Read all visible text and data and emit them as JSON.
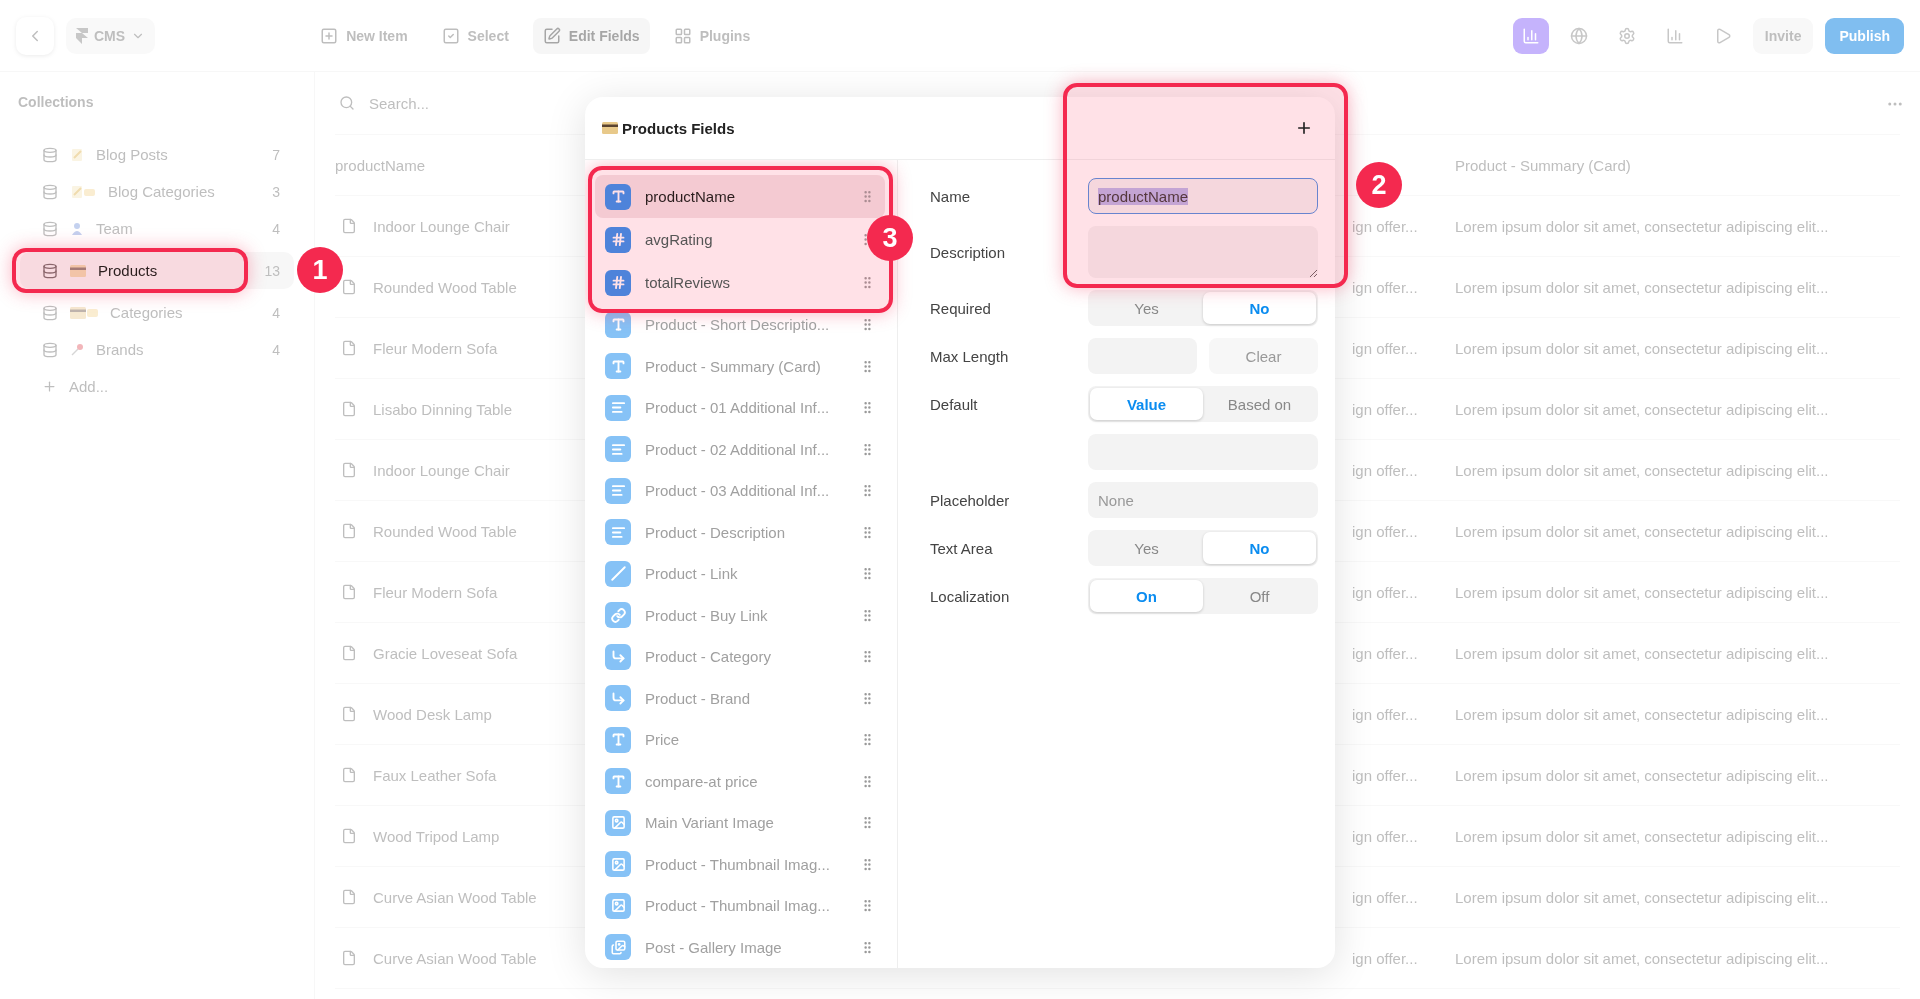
{
  "topbar": {
    "project": "CMS",
    "toolbar": [
      {
        "label": "New Item",
        "selected": false
      },
      {
        "label": "Select",
        "selected": false
      },
      {
        "label": "Edit Fields",
        "selected": true
      },
      {
        "label": "Plugins",
        "selected": false
      }
    ],
    "invite": "Invite",
    "publish": "Publish"
  },
  "sidebar": {
    "title": "Collections",
    "items": [
      {
        "name": "Blog Posts",
        "count": "7",
        "selected": false
      },
      {
        "name": "Blog Categories",
        "count": "3",
        "selected": false
      },
      {
        "name": "Team",
        "count": "4",
        "selected": false
      },
      {
        "name": "Products",
        "count": "13",
        "selected": true,
        "callout": "1"
      },
      {
        "name": "Categories",
        "count": "4",
        "selected": false
      },
      {
        "name": "Brands",
        "count": "4",
        "selected": false
      }
    ],
    "add": "Add..."
  },
  "table": {
    "search_placeholder": "Search...",
    "column_1": "productName",
    "column_3": "Product - Summary (Card)",
    "rows": [
      {
        "name": "Indoor Lounge Chair",
        "column_2": "ign offer...",
        "summary": "Lorem ipsum dolor sit amet, consectetur adipiscing elit..."
      },
      {
        "name": "Rounded Wood Table",
        "column_2": "ign offer...",
        "summary": "Lorem ipsum dolor sit amet, consectetur adipiscing elit..."
      },
      {
        "name": "Fleur Modern Sofa",
        "column_2": "ign offer...",
        "summary": "Lorem ipsum dolor sit amet, consectetur adipiscing elit..."
      },
      {
        "name": "Lisabo Dinning Table",
        "column_2": "ign offer...",
        "summary": "Lorem ipsum dolor sit amet, consectetur adipiscing elit..."
      },
      {
        "name": "Indoor Lounge Chair",
        "column_2": "ign offer...",
        "summary": "Lorem ipsum dolor sit amet, consectetur adipiscing elit..."
      },
      {
        "name": "Rounded Wood Table",
        "column_2": "ign offer...",
        "summary": "Lorem ipsum dolor sit amet, consectetur adipiscing elit..."
      },
      {
        "name": "Fleur Modern Sofa",
        "column_2": "ign offer...",
        "summary": "Lorem ipsum dolor sit amet, consectetur adipiscing elit..."
      },
      {
        "name": "Gracie Loveseat Sofa",
        "column_2": "ign offer...",
        "summary": "Lorem ipsum dolor sit amet, consectetur adipiscing elit..."
      },
      {
        "name": "Wood Desk Lamp",
        "column_2": "ign offer...",
        "summary": "Lorem ipsum dolor sit amet, consectetur adipiscing elit..."
      },
      {
        "name": "Faux Leather Sofa",
        "column_2": "ign offer...",
        "summary": "Lorem ipsum dolor sit amet, consectetur adipiscing elit..."
      },
      {
        "name": "Wood Tripod Lamp",
        "column_2": "ign offer...",
        "summary": "Lorem ipsum dolor sit amet, consectetur adipiscing elit..."
      },
      {
        "name": "Curve Asian Wood Table",
        "column_2": "ign offer...",
        "summary": "Lorem ipsum dolor sit amet, consectetur adipiscing elit..."
      },
      {
        "name": "Curve Asian Wood Table",
        "column_2": "ign offer...",
        "summary": "Lorem ipsum dolor sit amet, consectetur adipiscing elit..."
      }
    ]
  },
  "modal": {
    "title": "Products Fields",
    "header_callout": "2",
    "fields_callout": "3",
    "fields": [
      {
        "name": "productName",
        "kind": "text",
        "selected": true,
        "highlighted": true
      },
      {
        "name": "avgRating",
        "kind": "number",
        "selected": false,
        "highlighted": true
      },
      {
        "name": "totalReviews",
        "kind": "number",
        "selected": false,
        "highlighted": true
      },
      {
        "name": "Product - Short Descriptio...",
        "kind": "text",
        "selected": false,
        "highlighted": false
      },
      {
        "name": "Product - Summary (Card)",
        "kind": "text",
        "selected": false,
        "highlighted": false
      },
      {
        "name": "Product - 01 Additional Inf...",
        "kind": "formatted",
        "selected": false,
        "highlighted": false
      },
      {
        "name": "Product - 02 Additional Inf...",
        "kind": "formatted",
        "selected": false,
        "highlighted": false
      },
      {
        "name": "Product - 03 Additional Inf...",
        "kind": "formatted",
        "selected": false,
        "highlighted": false
      },
      {
        "name": "Product - Description",
        "kind": "formatted",
        "selected": false,
        "highlighted": false
      },
      {
        "name": "Product - Link",
        "kind": "link",
        "selected": false,
        "highlighted": false
      },
      {
        "name": "Product - Buy Link",
        "kind": "url",
        "selected": false,
        "highlighted": false
      },
      {
        "name": "Product - Category",
        "kind": "reference",
        "selected": false,
        "highlighted": false
      },
      {
        "name": "Product - Brand",
        "kind": "reference",
        "selected": false,
        "highlighted": false
      },
      {
        "name": "Price",
        "kind": "text",
        "selected": false,
        "highlighted": false
      },
      {
        "name": "compare-at price",
        "kind": "text",
        "selected": false,
        "highlighted": false
      },
      {
        "name": "Main Variant Image",
        "kind": "image",
        "selected": false,
        "highlighted": false
      },
      {
        "name": "Product - Thumbnail Imag...",
        "kind": "image",
        "selected": false,
        "highlighted": false
      },
      {
        "name": "Product - Thumbnail Imag...",
        "kind": "image",
        "selected": false,
        "highlighted": false
      },
      {
        "name": "Post - Gallery Image",
        "kind": "gallery",
        "selected": false,
        "highlighted": false
      }
    ],
    "settings": [
      {
        "label": "Name",
        "kind": "input",
        "value": "productName",
        "focused": true
      },
      {
        "label": "Description",
        "kind": "textarea"
      },
      {
        "label": "Required",
        "kind": "segmented",
        "options": [
          {
            "label": "Yes",
            "selected": false
          },
          {
            "label": "No",
            "selected": true
          }
        ]
      },
      {
        "label": "Max Length",
        "kind": "input_button",
        "button": "Clear"
      },
      {
        "label": "Default",
        "kind": "segmented",
        "options": [
          {
            "label": "Value",
            "selected": true
          },
          {
            "label": "Based on",
            "selected": false
          }
        ]
      },
      {
        "kind": "input"
      },
      {
        "label": "Placeholder",
        "kind": "input",
        "placeholder": "None"
      },
      {
        "label": "Text Area",
        "kind": "segmented",
        "options": [
          {
            "label": "Yes",
            "selected": false
          },
          {
            "label": "No",
            "selected": true
          }
        ]
      },
      {
        "label": "Localization",
        "kind": "segmented",
        "options": [
          {
            "label": "On",
            "selected": true
          },
          {
            "label": "Off",
            "selected": false
          }
        ]
      }
    ]
  }
}
